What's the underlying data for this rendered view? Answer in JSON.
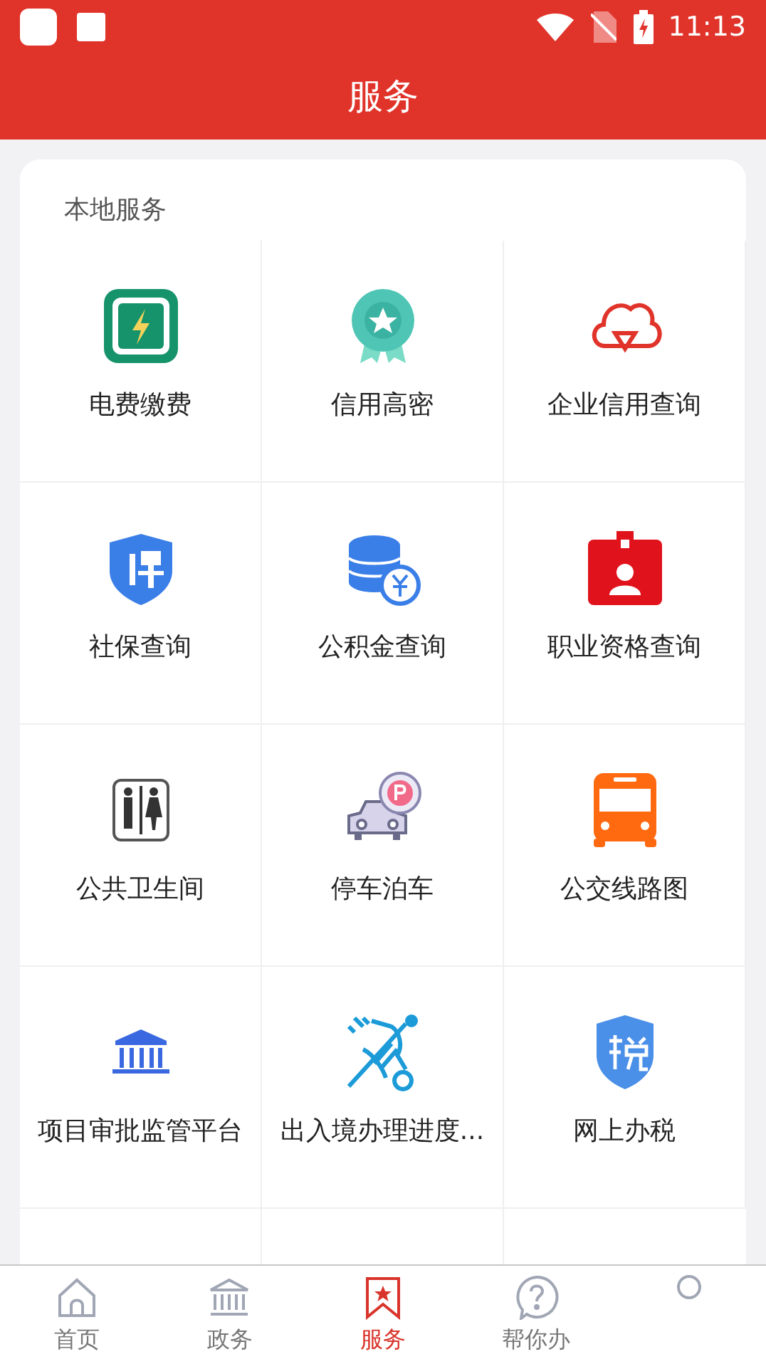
{
  "status_bar": {
    "time": "11:13"
  },
  "header": {
    "title": "服务"
  },
  "section": {
    "title": "本地服务",
    "items": [
      {
        "label": "电费缴费"
      },
      {
        "label": "信用高密"
      },
      {
        "label": "企业信用查询"
      },
      {
        "label": "社保查询"
      },
      {
        "label": "公积金查询"
      },
      {
        "label": "职业资格查询"
      },
      {
        "label": "公共卫生间"
      },
      {
        "label": "停车泊车"
      },
      {
        "label": "公交线路图"
      },
      {
        "label": "项目审批监管平台"
      },
      {
        "label": "出入境办理进度..."
      },
      {
        "label": "网上办税"
      }
    ]
  },
  "tab_bar": [
    {
      "label": "首页",
      "selected": false
    },
    {
      "label": "政务",
      "selected": false
    },
    {
      "label": "服务",
      "selected": true
    },
    {
      "label": "帮你办",
      "selected": false
    },
    {
      "selected": false
    }
  ]
}
